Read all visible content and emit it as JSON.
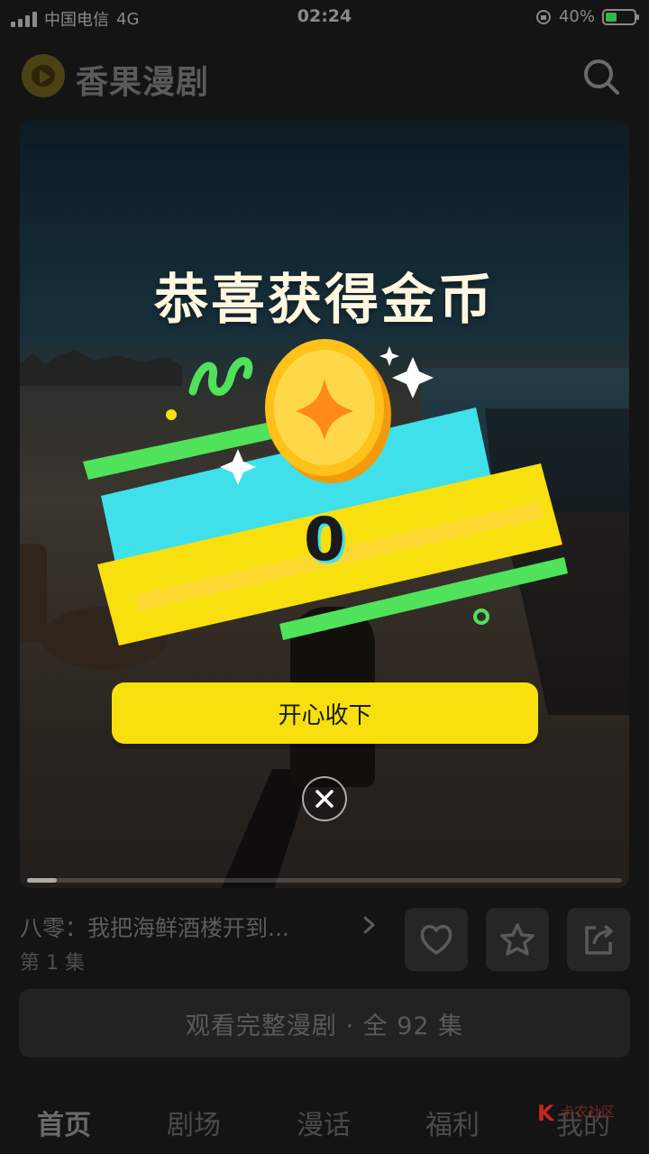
{
  "status_bar": {
    "carrier": "中国电信",
    "network": "4G",
    "time": "02:24",
    "battery": "40%",
    "battery_level": 0.4
  },
  "header": {
    "app_name": "香果漫剧",
    "search_icon": "search-icon",
    "logo_icon": "play-logo-icon"
  },
  "video": {
    "progress": 0.05
  },
  "reward_popup": {
    "title": "恭喜获得金币",
    "coin_amount": "0",
    "collect_label": "开心收下",
    "close_icon": "close-icon",
    "colors": {
      "ribbon_yellow": "#f7e00e",
      "ribbon_cyan": "#3fe0ea",
      "ribbon_green": "#4fe25a",
      "coin": "#ffc21a"
    }
  },
  "drama": {
    "title": "八零：我把海鲜酒楼开到...",
    "episode": "第 1 集",
    "actions": [
      "heart-icon",
      "star-icon",
      "share-icon"
    ]
  },
  "watch_full": {
    "label": "观看完整漫剧 · 全 92 集"
  },
  "bottom_nav": {
    "items": [
      {
        "label": "首页",
        "active": true
      },
      {
        "label": "剧场",
        "active": false
      },
      {
        "label": "漫话",
        "active": false
      },
      {
        "label": "福利",
        "active": false
      },
      {
        "label": "我的",
        "active": false
      }
    ]
  },
  "watermark": {
    "text": "卡农社区"
  }
}
